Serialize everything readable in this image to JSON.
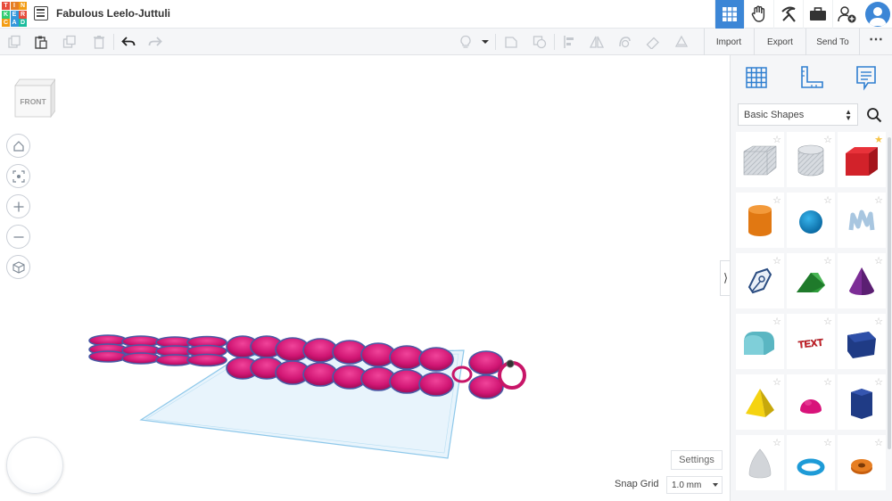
{
  "app": {
    "logo_letters": [
      "T",
      "I",
      "N",
      "K",
      "E",
      "R",
      "C",
      "A",
      "D"
    ],
    "logo_colors": [
      "#e74c3c",
      "#e67e22",
      "#f39c12",
      "#2ecc71",
      "#3498db",
      "#e74c3c",
      "#f39c12",
      "#3498db",
      "#1abc9c"
    ],
    "project_title": "Fabulous Leelo-Juttuli",
    "accent_color": "#3c86d6"
  },
  "topnav": {
    "items": [
      {
        "name": "3d-design-view",
        "icon": "grid-icon",
        "active": true
      },
      {
        "name": "blocks-view",
        "icon": "hand-icon",
        "active": false
      },
      {
        "name": "build-view",
        "icon": "pickaxe-icon",
        "active": false
      },
      {
        "name": "lesson-view",
        "icon": "briefcase-icon",
        "active": false
      },
      {
        "name": "invite-user",
        "icon": "add-user-icon",
        "active": false
      }
    ]
  },
  "toolbar": {
    "import_label": "Import",
    "export_label": "Export",
    "send_to_label": "Send To"
  },
  "viewcube": {
    "face_label": "FRONT"
  },
  "navigation": [
    "home-icon",
    "fit-all-icon",
    "zoom-in-icon",
    "zoom-out-icon",
    "perspective-icon"
  ],
  "bottom": {
    "settings_label": "Settings",
    "snap_grid_label": "Snap Grid",
    "snap_grid_value": "1.0 mm"
  },
  "panel": {
    "tabs": [
      "workplane-icon",
      "ruler-icon",
      "notes-icon"
    ],
    "library_selected": "Basic Shapes",
    "shapes": [
      {
        "name": "box-hole",
        "favorite": false
      },
      {
        "name": "cylinder-hole",
        "favorite": false
      },
      {
        "name": "box",
        "favorite": true
      },
      {
        "name": "cylinder",
        "favorite": false
      },
      {
        "name": "sphere",
        "favorite": false
      },
      {
        "name": "scribble",
        "favorite": false
      },
      {
        "name": "shape-generator",
        "favorite": false
      },
      {
        "name": "roof",
        "favorite": false
      },
      {
        "name": "cone",
        "favorite": false
      },
      {
        "name": "round-roof",
        "favorite": false
      },
      {
        "name": "text",
        "favorite": false,
        "label": "TEXT"
      },
      {
        "name": "polygon",
        "favorite": false
      },
      {
        "name": "pyramid",
        "favorite": false
      },
      {
        "name": "half-sphere",
        "favorite": false
      },
      {
        "name": "polygon-hex",
        "favorite": false
      },
      {
        "name": "paraboloid",
        "favorite": false
      },
      {
        "name": "torus",
        "favorite": false
      },
      {
        "name": "tube",
        "favorite": false
      }
    ]
  }
}
